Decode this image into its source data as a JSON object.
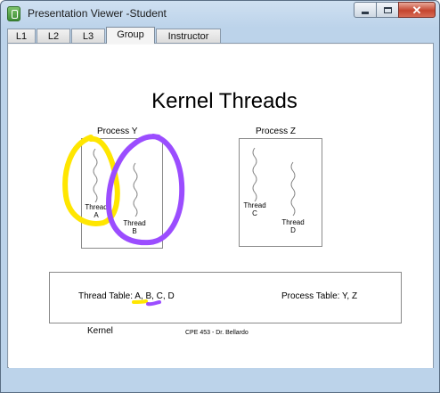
{
  "window": {
    "title": "Presentation Viewer -Student",
    "close_symbol": "✕"
  },
  "tabs": [
    {
      "label": "L1",
      "active": false
    },
    {
      "label": "L2",
      "active": false
    },
    {
      "label": "L3",
      "active": false
    },
    {
      "label": "Group",
      "active": true
    },
    {
      "label": "Instructor",
      "active": false
    }
  ],
  "slide": {
    "title": "Kernel Threads",
    "process_y": {
      "label": "Process Y",
      "thread_a": {
        "line1": "Thread",
        "line2": "A"
      },
      "thread_b": {
        "line1": "Thread",
        "line2": "B"
      }
    },
    "process_z": {
      "label": "Process Z",
      "thread_c": {
        "line1": "Thread",
        "line2": "C"
      },
      "thread_d": {
        "line1": "Thread",
        "line2": "D"
      }
    },
    "kernel": {
      "label": "Kernel",
      "thread_table_prefix": "Thread Table: ",
      "thread_table_entries": [
        "A",
        "B",
        "C",
        "D"
      ],
      "process_table": "Process Table: Y, Z"
    },
    "footer": "CPE 453 - Dr. Bellardo"
  },
  "annotations": [
    {
      "name": "yellow-circle-thread-a",
      "color": "#ffe600"
    },
    {
      "name": "purple-circle-thread-b",
      "color": "#9b4dff"
    },
    {
      "name": "yellow-underline-a",
      "color": "#ffe600"
    },
    {
      "name": "purple-underline-b",
      "color": "#9b4dff"
    }
  ],
  "colors": {
    "yellow_ink": "#ffe600",
    "purple_ink": "#9b4dff",
    "close_button": "#c5452f"
  }
}
